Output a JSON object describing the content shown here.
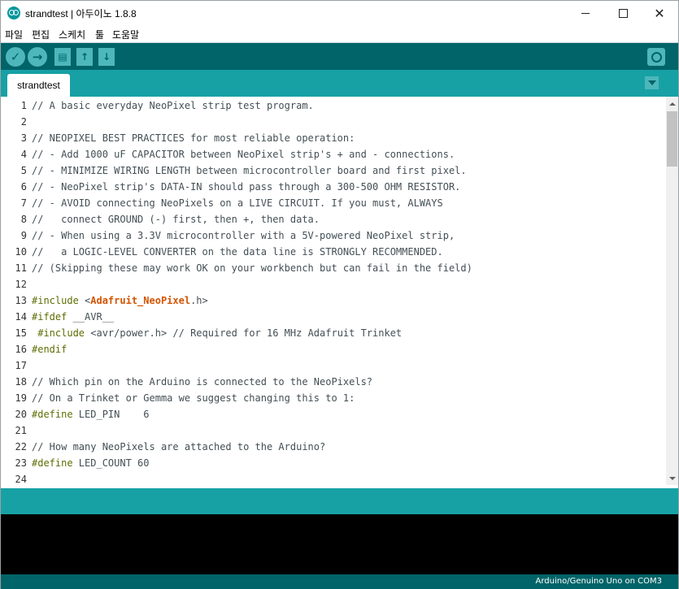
{
  "window": {
    "title": "strandtest | 아두이노 1.8.8",
    "controls": {
      "minimize": "",
      "maximize": "",
      "close": "✕"
    }
  },
  "menu": [
    "파일",
    "편집",
    "스케치",
    "툴",
    "도움말"
  ],
  "toolbar": {
    "verify": "✓",
    "upload": "→",
    "new": "▤",
    "open": "↑",
    "save": "↓"
  },
  "tabs": [
    {
      "label": "strandtest"
    }
  ],
  "editor": {
    "lines": [
      [
        [
          "c",
          "// A basic everyday NeoPixel strip test program."
        ]
      ],
      [],
      [
        [
          "c",
          "// NEOPIXEL BEST PRACTICES for most reliable operation:"
        ]
      ],
      [
        [
          "c",
          "// - Add 1000 uF CAPACITOR between NeoPixel strip's + and - connections."
        ]
      ],
      [
        [
          "c",
          "// - MINIMIZE WIRING LENGTH between microcontroller board and first pixel."
        ]
      ],
      [
        [
          "c",
          "// - NeoPixel strip's DATA-IN should pass through a 300-500 OHM RESISTOR."
        ]
      ],
      [
        [
          "c",
          "// - AVOID connecting NeoPixels on a LIVE CIRCUIT. If you must, ALWAYS"
        ]
      ],
      [
        [
          "c",
          "//   connect GROUND (-) first, then +, then data."
        ]
      ],
      [
        [
          "c",
          "// - When using a 3.3V microcontroller with a 5V-powered NeoPixel strip,"
        ]
      ],
      [
        [
          "c",
          "//   a LOGIC-LEVEL CONVERTER on the data line is STRONGLY RECOMMENDED."
        ]
      ],
      [
        [
          "c",
          "// (Skipping these may work OK on your workbench but can fail in the field)"
        ]
      ],
      [],
      [
        [
          "k",
          "#include"
        ],
        [
          "c",
          " <"
        ],
        [
          "l",
          "Adafruit_NeoPixel"
        ],
        [
          "c",
          ".h>"
        ]
      ],
      [
        [
          "k",
          "#ifdef"
        ],
        [
          "c",
          " __AVR__"
        ]
      ],
      [
        [
          "c",
          " "
        ],
        [
          "k",
          "#include"
        ],
        [
          "c",
          " <avr/power.h> // Required for 16 MHz Adafruit Trinket"
        ]
      ],
      [
        [
          "k",
          "#endif"
        ]
      ],
      [],
      [
        [
          "c",
          "// Which pin on the Arduino is connected to the NeoPixels?"
        ]
      ],
      [
        [
          "c",
          "// On a Trinket or Gemma we suggest changing this to 1:"
        ]
      ],
      [
        [
          "k",
          "#define"
        ],
        [
          "c",
          " LED_PIN    6"
        ]
      ],
      [],
      [
        [
          "c",
          "// How many NeoPixels are attached to the Arduino?"
        ]
      ],
      [
        [
          "k",
          "#define"
        ],
        [
          "c",
          " LED_COUNT 60"
        ]
      ],
      []
    ]
  },
  "status": {
    "board": "Arduino/Genuino Uno on COM3"
  },
  "colors": {
    "toolbar": "#006468",
    "tabbar": "#17a1a5",
    "button": "#4db7bb",
    "keyword": "#5e6d03",
    "library": "#d35400",
    "comment": "#434f54"
  }
}
